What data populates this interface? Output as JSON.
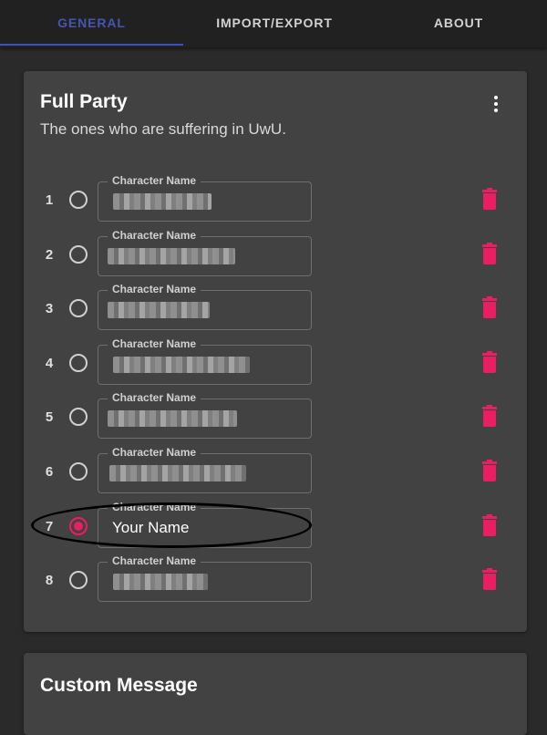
{
  "tabs": [
    {
      "label": "GENERAL",
      "active": true
    },
    {
      "label": "IMPORT/EXPORT",
      "active": false
    },
    {
      "label": "ABOUT",
      "active": false
    }
  ],
  "party_card": {
    "title": "Full Party",
    "subtitle": "The ones who are suffering in UwU.",
    "menu_icon": "more-vert-icon",
    "rows": [
      {
        "number": "1",
        "field_label": "Character Name",
        "value": "",
        "obscured": true,
        "selected": false
      },
      {
        "number": "2",
        "field_label": "Character Name",
        "value": "",
        "obscured": true,
        "selected": false
      },
      {
        "number": "3",
        "field_label": "Character Name",
        "value": "",
        "obscured": true,
        "selected": false
      },
      {
        "number": "4",
        "field_label": "Character Name",
        "value": "",
        "obscured": true,
        "selected": false
      },
      {
        "number": "5",
        "field_label": "Character Name",
        "value": "",
        "obscured": true,
        "selected": false
      },
      {
        "number": "6",
        "field_label": "Character Name",
        "value": "",
        "obscured": true,
        "selected": false
      },
      {
        "number": "7",
        "field_label": "Character Name",
        "value": "Your Name",
        "obscured": false,
        "selected": true
      },
      {
        "number": "8",
        "field_label": "Character Name",
        "value": "",
        "obscured": true,
        "selected": false
      }
    ],
    "delete_icon": "trash-icon"
  },
  "custom_card": {
    "title": "Custom Message"
  },
  "colors": {
    "accent": "#e91e63",
    "tab_active": "#3f51b5",
    "card_bg": "#424242",
    "page_bg": "#2a2a2a"
  }
}
